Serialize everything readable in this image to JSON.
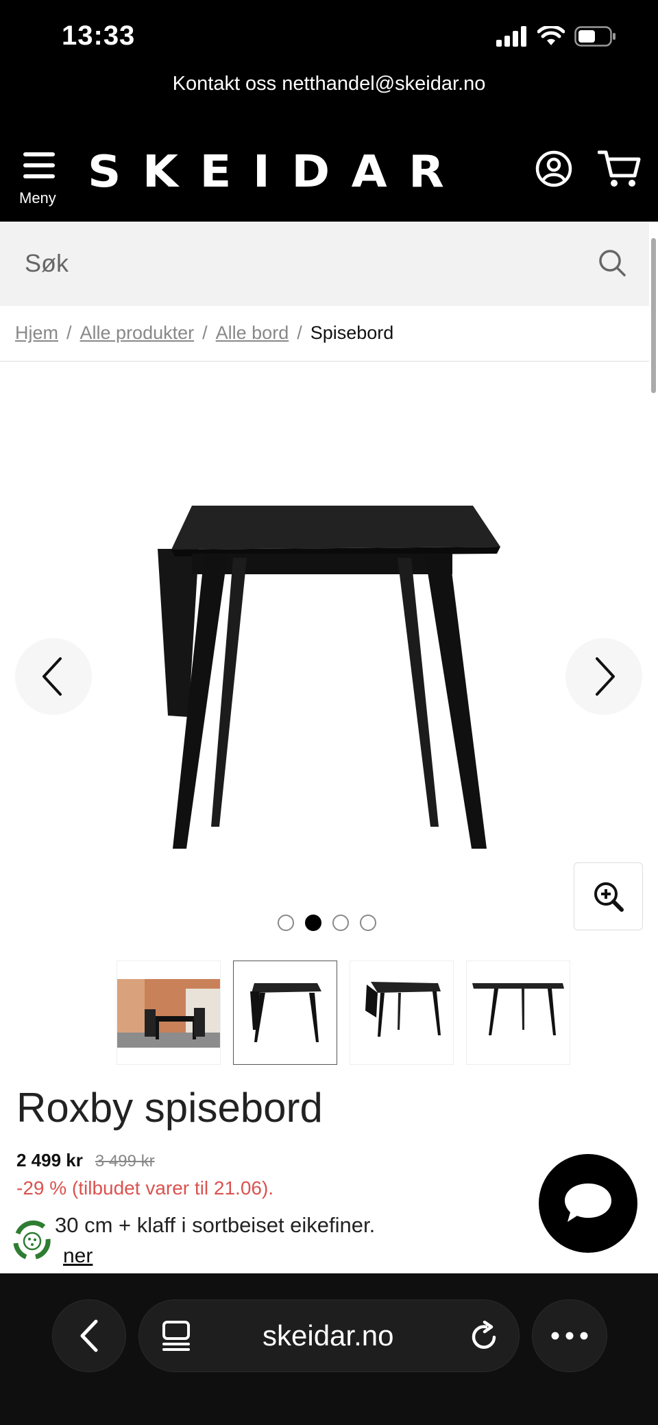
{
  "status_bar": {
    "time": "13:33"
  },
  "contact_bar": {
    "text": "Kontakt oss netthandel@skeidar.no"
  },
  "header": {
    "menu_label": "Meny",
    "logo": "SKEIDAR"
  },
  "search": {
    "placeholder": "Søk"
  },
  "breadcrumb": {
    "items": [
      "Hjem",
      "Alle produkter",
      "Alle bord"
    ],
    "current": "Spisebord",
    "separator": "/"
  },
  "gallery": {
    "total_images": 4,
    "active_index": 1
  },
  "product": {
    "title": "Roxby spisebord",
    "price": "2 499 kr",
    "old_price": "3 499 kr",
    "discount": "-29 % (tilbudet varer til 21.06).",
    "description": "30 cm + klaff i sortbeiset eikefiner.",
    "more_link": "ner"
  },
  "browser": {
    "url": "skeidar.no"
  },
  "colors": {
    "header_bg": "#000000",
    "search_bg": "#f2f2f2",
    "discount": "#d9534f",
    "browser_bg": "#0f0f0f"
  }
}
